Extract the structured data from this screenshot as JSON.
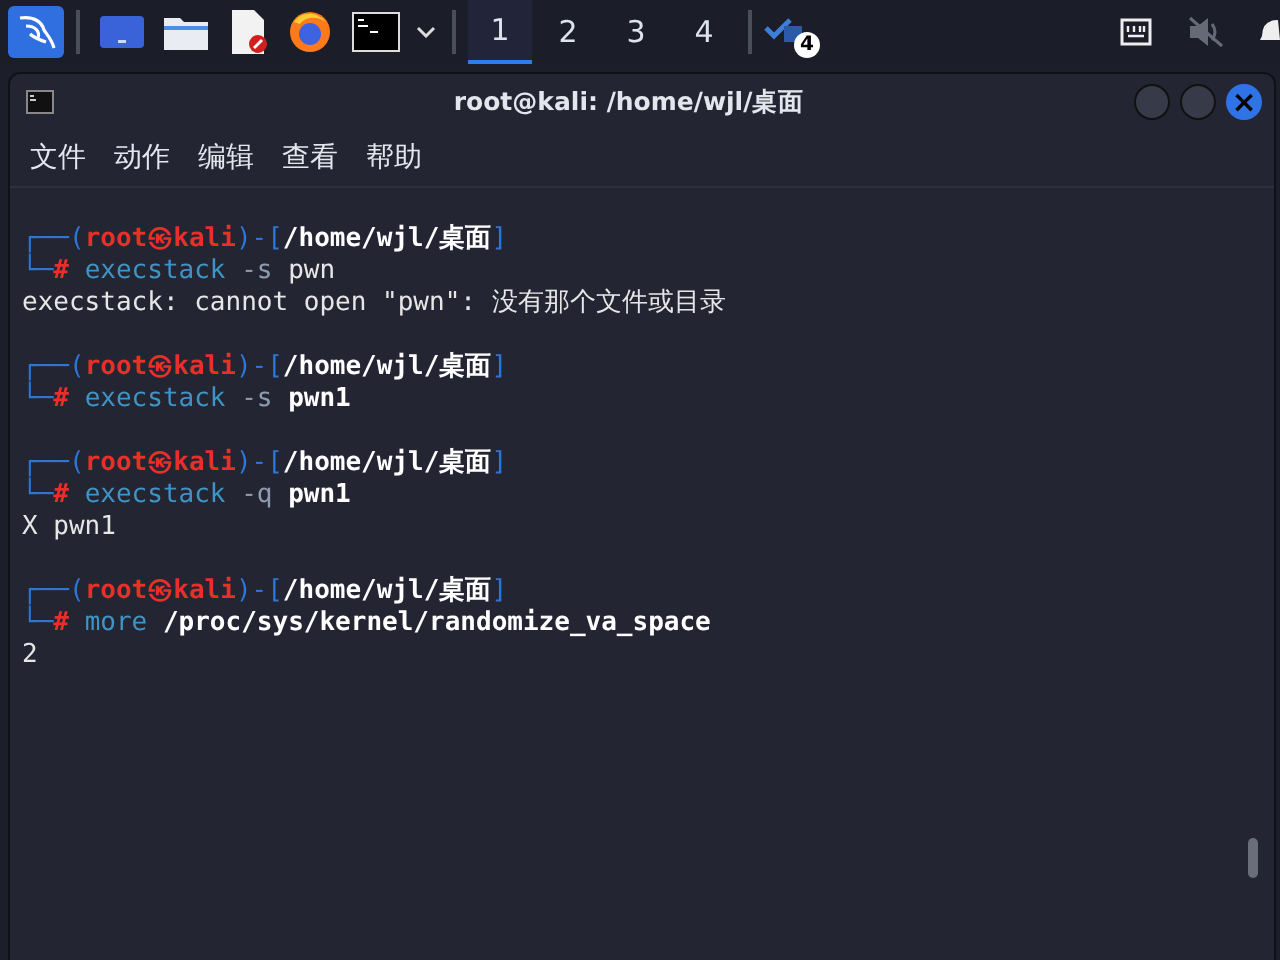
{
  "taskbar": {
    "workspaces": [
      {
        "label": "1",
        "selected": true
      },
      {
        "label": "2",
        "selected": false
      },
      {
        "label": "3",
        "selected": false
      },
      {
        "label": "4",
        "selected": false
      }
    ],
    "updates_badge": "4"
  },
  "window": {
    "title": "root@kali: /home/wjl/桌面",
    "close_glyph": "×"
  },
  "menu": [
    "文件",
    "动作",
    "编辑",
    "查看",
    "帮助"
  ],
  "terminal": {
    "lines": [
      {
        "kind": "blank"
      },
      {
        "kind": "prompt",
        "open": "┌──(",
        "user": "root",
        "at": "㉿",
        "host": "kali",
        "mid": ")-[",
        "path": "/home/wjl/桌面",
        "close": "]"
      },
      {
        "kind": "command",
        "corner": "└─",
        "symbol": "#",
        "tokens": [
          {
            "text": "execstack",
            "kind": "program"
          },
          {
            "text": "-s",
            "kind": "option"
          },
          {
            "text": "pwn",
            "kind": "argument"
          }
        ]
      },
      {
        "kind": "output",
        "text": "execstack: cannot open \"pwn\": 没有那个文件或目录"
      },
      {
        "kind": "blank"
      },
      {
        "kind": "prompt",
        "open": "┌──(",
        "user": "root",
        "at": "㉿",
        "host": "kali",
        "mid": ")-[",
        "path": "/home/wjl/桌面",
        "close": "]"
      },
      {
        "kind": "command",
        "corner": "└─",
        "symbol": "#",
        "tokens": [
          {
            "text": "execstack",
            "kind": "program"
          },
          {
            "text": "-s",
            "kind": "option"
          },
          {
            "text": "pwn1",
            "kind": "file"
          }
        ]
      },
      {
        "kind": "blank"
      },
      {
        "kind": "prompt",
        "open": "┌──(",
        "user": "root",
        "at": "㉿",
        "host": "kali",
        "mid": ")-[",
        "path": "/home/wjl/桌面",
        "close": "]"
      },
      {
        "kind": "command",
        "corner": "└─",
        "symbol": "#",
        "tokens": [
          {
            "text": "execstack",
            "kind": "program"
          },
          {
            "text": "-q",
            "kind": "option"
          },
          {
            "text": "pwn1",
            "kind": "file"
          }
        ]
      },
      {
        "kind": "output",
        "text": "X pwn1"
      },
      {
        "kind": "blank"
      },
      {
        "kind": "prompt",
        "open": "┌──(",
        "user": "root",
        "at": "㉿",
        "host": "kali",
        "mid": ")-[",
        "path": "/home/wjl/桌面",
        "close": "]"
      },
      {
        "kind": "command",
        "corner": "└─",
        "symbol": "#",
        "tokens": [
          {
            "text": "more",
            "kind": "program"
          },
          {
            "text": "/proc/sys/kernel/randomize_va_space",
            "kind": "file"
          }
        ]
      },
      {
        "kind": "output",
        "text": "2"
      }
    ]
  }
}
